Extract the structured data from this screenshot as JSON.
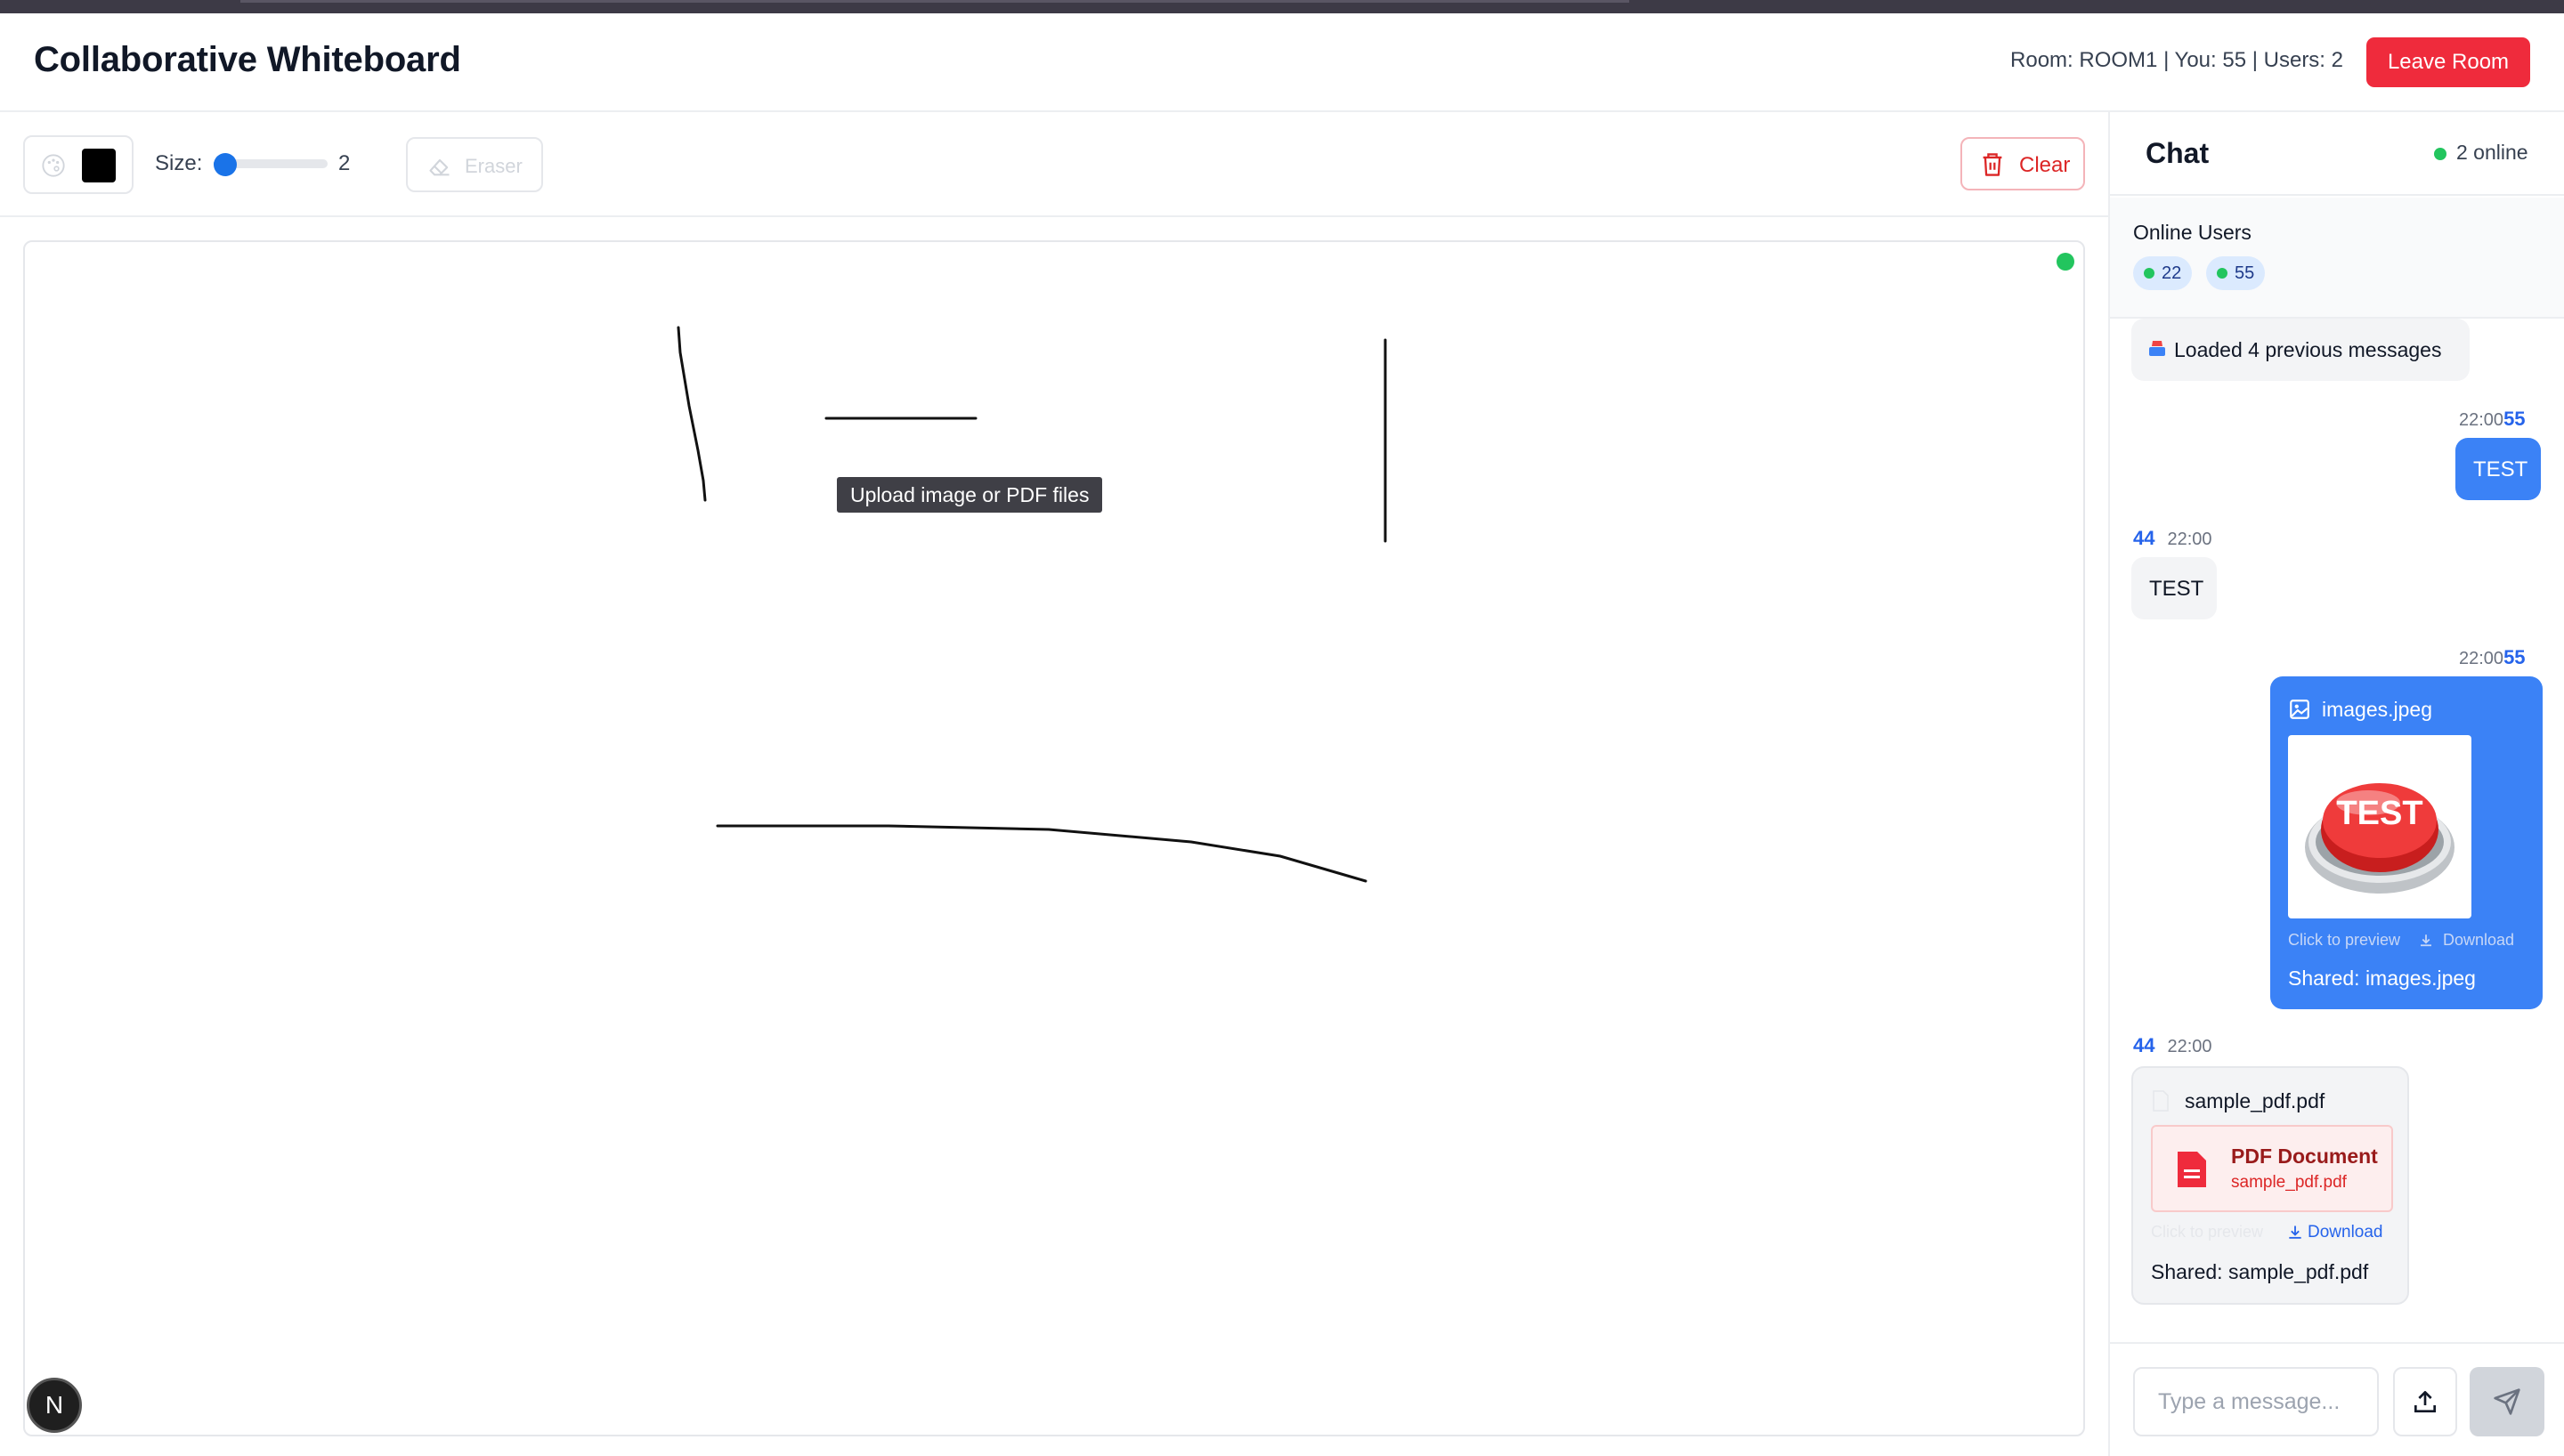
{
  "header": {
    "title": "Collaborative Whiteboard",
    "room_info": "Room: ROOM1 | You: 55 | Users: 2",
    "leave_label": "Leave Room"
  },
  "toolbar": {
    "size_label": "Size:",
    "size_value": "2",
    "size_fraction": 0.1,
    "selected_color": "#000000",
    "eraser_label": "Eraser",
    "clear_label": "Clear"
  },
  "canvas": {
    "tooltip": "Upload image or PDF files",
    "connection_status_color": "#22c55e",
    "badge": "N"
  },
  "chat": {
    "title": "Chat",
    "online_count": "2 online",
    "online_users_title": "Online Users",
    "online_users": [
      "22",
      "55"
    ],
    "system_message": "Loaded 4 previous messages",
    "messages": [
      {
        "time": "22:00",
        "user": "55",
        "text": "TEST"
      },
      {
        "user": "44",
        "time": "22:00",
        "text": "TEST"
      },
      {
        "time": "22:00",
        "user": "55",
        "file_name": "images.jpeg",
        "thumb_text": "TEST",
        "preview_label": "Click to preview",
        "download_label": "Download",
        "shared_text": "Shared: images.jpeg"
      },
      {
        "user": "44",
        "time": "22:00",
        "file_name": "sample_pdf.pdf",
        "doc_title": "PDF Document",
        "doc_sub": "sample_pdf.pdf",
        "preview_label": "Click to preview",
        "download_label": "Download",
        "shared_text": "Shared: sample_pdf.pdf"
      }
    ],
    "input_placeholder": "Type a message..."
  },
  "colors": {
    "accent": "#3b82f6",
    "danger": "#ef2b3c",
    "online": "#22c55e"
  },
  "icons": [
    "palette-icon",
    "eraser-icon",
    "trash-icon",
    "image-file-icon",
    "file-icon",
    "pdf-icon",
    "download-icon",
    "upload-icon",
    "send-icon",
    "inbox-icon"
  ]
}
